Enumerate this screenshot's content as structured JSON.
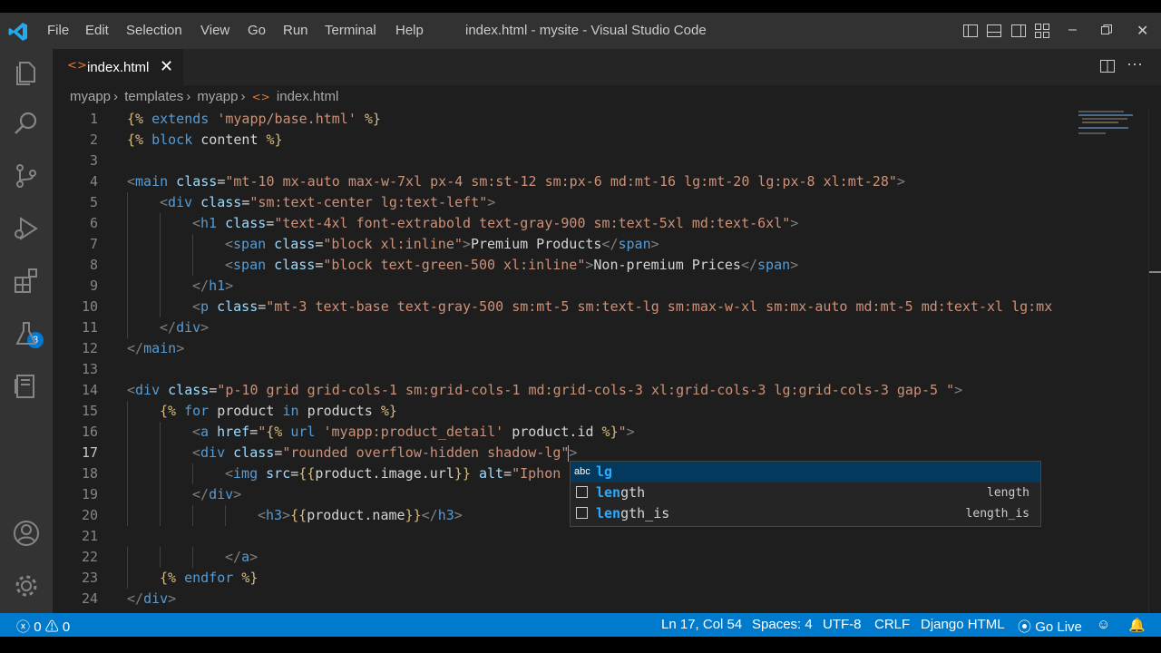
{
  "window": {
    "title": "index.html - mysite - Visual Studio Code"
  },
  "menu": [
    "File",
    "Edit",
    "Selection",
    "View",
    "Go",
    "Run",
    "Terminal",
    "Help"
  ],
  "activity_bar": {
    "extensions_badge": "3"
  },
  "tab": {
    "label": "index.html",
    "icon": "html-file-icon"
  },
  "breadcrumb": [
    "myapp",
    "templates",
    "myapp",
    "index.html"
  ],
  "editor": {
    "current_line": 17,
    "lines": [
      {
        "n": "1",
        "indent": 0,
        "parts": [
          [
            "dj",
            "{%"
          ],
          [
            "kw",
            " extends "
          ],
          [
            "djt",
            "'myapp/base.html'"
          ],
          [
            "dj",
            " %}"
          ]
        ]
      },
      {
        "n": "2",
        "indent": 0,
        "parts": [
          [
            "dj",
            "{%"
          ],
          [
            "kw",
            " block "
          ],
          [
            "tx",
            "content"
          ],
          [
            "dj",
            " %}"
          ]
        ]
      },
      {
        "n": "3",
        "indent": 0,
        "parts": []
      },
      {
        "n": "4",
        "indent": 0,
        "parts": [
          [
            "tg",
            "<"
          ],
          [
            "tn",
            "main"
          ],
          [
            "at",
            " class"
          ],
          [
            "tx",
            "="
          ],
          [
            "sv",
            "\"mt-10 mx-auto max-w-7xl px-4 sm:st-12 sm:px-6 md:mt-16 lg:mt-20 lg:px-8 xl:mt-28\""
          ],
          [
            "tg",
            ">"
          ]
        ]
      },
      {
        "n": "5",
        "indent": 1,
        "parts": [
          [
            "tg",
            "<"
          ],
          [
            "tn",
            "div"
          ],
          [
            "at",
            " class"
          ],
          [
            "tx",
            "="
          ],
          [
            "sv",
            "\"sm:text-center lg:text-left\""
          ],
          [
            "tg",
            ">"
          ]
        ]
      },
      {
        "n": "6",
        "indent": 2,
        "parts": [
          [
            "tg",
            "<"
          ],
          [
            "tn",
            "h1"
          ],
          [
            "at",
            " class"
          ],
          [
            "tx",
            "="
          ],
          [
            "sv",
            "\"text-4xl font-extrabold text-gray-900 sm:text-5xl md:text-6xl\""
          ],
          [
            "tg",
            ">"
          ]
        ]
      },
      {
        "n": "7",
        "indent": 3,
        "parts": [
          [
            "tg",
            "<"
          ],
          [
            "tn",
            "span"
          ],
          [
            "at",
            " class"
          ],
          [
            "tx",
            "="
          ],
          [
            "sv",
            "\"block xl:inline\""
          ],
          [
            "tg",
            ">"
          ],
          [
            "tx",
            "Premium Products"
          ],
          [
            "tg",
            "</"
          ],
          [
            "tn",
            "span"
          ],
          [
            "tg",
            ">"
          ]
        ]
      },
      {
        "n": "8",
        "indent": 3,
        "parts": [
          [
            "tg",
            "<"
          ],
          [
            "tn",
            "span"
          ],
          [
            "at",
            " class"
          ],
          [
            "tx",
            "="
          ],
          [
            "sv",
            "\"block text-green-500 xl:inline\""
          ],
          [
            "tg",
            ">"
          ],
          [
            "tx",
            "Non-premium Prices"
          ],
          [
            "tg",
            "</"
          ],
          [
            "tn",
            "span"
          ],
          [
            "tg",
            ">"
          ]
        ]
      },
      {
        "n": "9",
        "indent": 2,
        "parts": [
          [
            "tg",
            "</"
          ],
          [
            "tn",
            "h1"
          ],
          [
            "tg",
            ">"
          ]
        ]
      },
      {
        "n": "10",
        "indent": 2,
        "parts": [
          [
            "tg",
            "<"
          ],
          [
            "tn",
            "p"
          ],
          [
            "at",
            " class"
          ],
          [
            "tx",
            "="
          ],
          [
            "sv",
            "\"mt-3 text-base text-gray-500 sm:mt-5 sm:text-lg sm:max-w-xl sm:mx-auto md:mt-5 md:text-xl lg:mx"
          ]
        ]
      },
      {
        "n": "11",
        "indent": 1,
        "parts": [
          [
            "tg",
            "</"
          ],
          [
            "tn",
            "div"
          ],
          [
            "tg",
            ">"
          ]
        ]
      },
      {
        "n": "12",
        "indent": 0,
        "parts": [
          [
            "tg",
            "</"
          ],
          [
            "tn",
            "main"
          ],
          [
            "tg",
            ">"
          ]
        ]
      },
      {
        "n": "13",
        "indent": 0,
        "parts": []
      },
      {
        "n": "14",
        "indent": 0,
        "parts": [
          [
            "tg",
            "<"
          ],
          [
            "tn",
            "div"
          ],
          [
            "at",
            " class"
          ],
          [
            "tx",
            "="
          ],
          [
            "sv",
            "\"p-10 grid grid-cols-1 sm:grid-cols-1 md:grid-cols-3 xl:grid-cols-3 lg:grid-cols-3 gap-5 \""
          ],
          [
            "tg",
            ">"
          ]
        ]
      },
      {
        "n": "15",
        "indent": 1,
        "parts": [
          [
            "dj",
            "{%"
          ],
          [
            "kw",
            " for "
          ],
          [
            "tx",
            "product"
          ],
          [
            "kw",
            " in "
          ],
          [
            "tx",
            "products"
          ],
          [
            "dj",
            " %}"
          ]
        ]
      },
      {
        "n": "16",
        "indent": 2,
        "parts": [
          [
            "tg",
            "<"
          ],
          [
            "tn",
            "a"
          ],
          [
            "at",
            " href"
          ],
          [
            "tx",
            "="
          ],
          [
            "sv",
            "\""
          ],
          [
            "dj",
            "{%"
          ],
          [
            "kw",
            " url "
          ],
          [
            "djt",
            "'myapp:product_detail'"
          ],
          [
            "tx",
            " product.id"
          ],
          [
            "dj",
            " %}"
          ],
          [
            "sv",
            "\""
          ],
          [
            "tg",
            ">"
          ]
        ]
      },
      {
        "n": "17",
        "indent": 2,
        "parts": [
          [
            "tg",
            "<"
          ],
          [
            "tn",
            "div"
          ],
          [
            "at",
            " class"
          ],
          [
            "tx",
            "="
          ],
          [
            "sv",
            "\"rounded overflow-hidden shadow-lg\""
          ],
          [
            "tg",
            ">"
          ]
        ]
      },
      {
        "n": "18",
        "indent": 3,
        "parts": [
          [
            "tg",
            "<"
          ],
          [
            "tn",
            "img"
          ],
          [
            "at",
            " src"
          ],
          [
            "tx",
            "="
          ],
          [
            "dj",
            "{{"
          ],
          [
            "tx",
            "product.image.url"
          ],
          [
            "dj",
            "}}"
          ],
          [
            "at",
            " alt"
          ],
          [
            "tx",
            "="
          ],
          [
            "sv",
            "\"Iphon"
          ]
        ]
      },
      {
        "n": "19",
        "indent": 2,
        "parts": [
          [
            "tg",
            "</"
          ],
          [
            "tn",
            "div"
          ],
          [
            "tg",
            ">"
          ]
        ]
      },
      {
        "n": "20",
        "indent": 4,
        "parts": [
          [
            "tg",
            "<"
          ],
          [
            "tn",
            "h3"
          ],
          [
            "tg",
            ">"
          ],
          [
            "dj",
            "{{"
          ],
          [
            "tx",
            "product.name"
          ],
          [
            "dj",
            "}}"
          ],
          [
            "tg",
            "</"
          ],
          [
            "tn",
            "h3"
          ],
          [
            "tg",
            ">"
          ]
        ]
      },
      {
        "n": "21",
        "indent": 0,
        "parts": []
      },
      {
        "n": "22",
        "indent": 3,
        "parts": [
          [
            "tg",
            "</"
          ],
          [
            "tn",
            "a"
          ],
          [
            "tg",
            ">"
          ]
        ]
      },
      {
        "n": "23",
        "indent": 1,
        "parts": [
          [
            "dj",
            "{%"
          ],
          [
            "kw",
            " endfor "
          ],
          [
            "dj",
            "%}"
          ]
        ]
      },
      {
        "n": "24",
        "indent": 0,
        "parts": [
          [
            "tg",
            "</"
          ],
          [
            "tn",
            "div"
          ],
          [
            "tg",
            ">"
          ]
        ]
      }
    ]
  },
  "suggest": [
    {
      "prefix": "lg",
      "rest": "",
      "detail": "",
      "icon": "abc",
      "selected": true
    },
    {
      "prefix": "len",
      "rest": "gth",
      "detail": "length",
      "icon": "box",
      "selected": false
    },
    {
      "prefix": "len",
      "rest": "gth_is",
      "detail": "length_is",
      "icon": "box",
      "selected": false
    }
  ],
  "statusbar": {
    "errors": "0",
    "warnings": "0",
    "position": "Ln 17, Col 54",
    "spaces": "Spaces: 4",
    "encoding": "UTF-8",
    "eol": "CRLF",
    "language": "Django HTML",
    "golive": "Go Live"
  },
  "colors": {
    "statusbar": "#007acc",
    "accent": "#0078d4",
    "selection": "#04395e"
  }
}
